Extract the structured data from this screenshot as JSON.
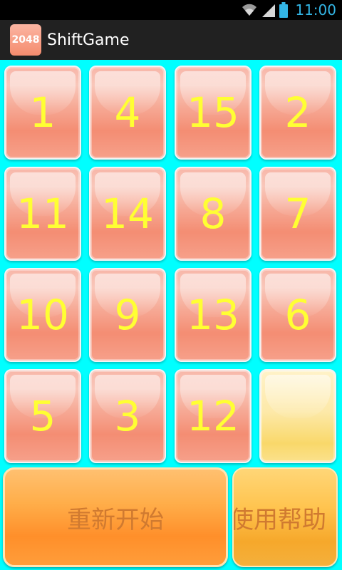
{
  "status_bar": {
    "time": "11:00"
  },
  "app": {
    "icon_label": "2048",
    "title": "ShiftGame"
  },
  "board": {
    "rows": [
      [
        "1",
        "4",
        "15",
        "2"
      ],
      [
        "11",
        "14",
        "8",
        "7"
      ],
      [
        "10",
        "9",
        "13",
        "6"
      ],
      [
        "5",
        "3",
        "12",
        ""
      ]
    ]
  },
  "buttons": {
    "restart": "重新开始",
    "help": "使用帮助"
  },
  "colors": {
    "background": "#00ffff",
    "tile_text": "#ffff33",
    "tile": "#f6a894",
    "empty_tile": "#fde9a9"
  }
}
